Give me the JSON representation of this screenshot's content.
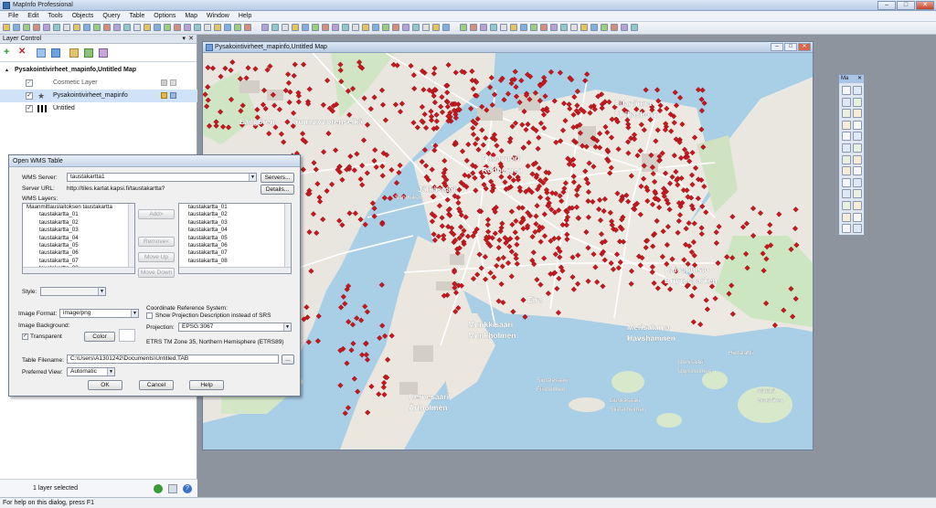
{
  "app": {
    "title": "MapInfo Professional"
  },
  "menu": [
    "File",
    "Edit",
    "Tools",
    "Objects",
    "Query",
    "Table",
    "Options",
    "Map",
    "Window",
    "Help"
  ],
  "layer_control": {
    "title": "Layer Control",
    "root": "Pysakointivirheet_mapinfo,Untitled Map",
    "layers": [
      "Cosmetic Layer",
      "Pysakointivirheet_mapinfo",
      "Untitled"
    ],
    "status": "1 layer selected"
  },
  "map_window": {
    "title": "Pysakointivirheet_mapinfo,Untitled Map",
    "labels": [
      "Punavuori",
      "Rödbergen",
      "Ullanlinna",
      "Ulrikasborg",
      "Kaivopuisto",
      "Brunnsparken",
      "Munkkisaari",
      "Munkholmen",
      "Merisatama",
      "Havshamnen",
      "Hernesaari",
      "Ärtholmen",
      "Jätkäsaari",
      "Sandviken",
      "Sirpalesaari",
      "Flisholmen",
      "Liuskasaari",
      "Skifferholmen",
      "Uunisaari",
      "Ugnsholmen",
      "Särkkä",
      "Langören",
      "Kruunuvuorenselkä",
      "Grasviken",
      "Hietalahti",
      "Eira"
    ],
    "point_color": "#c8181e"
  },
  "palette": {
    "title": "Ma"
  },
  "dialog": {
    "title": "Open WMS Table",
    "wms_server_label": "WMS Server:",
    "wms_server_value": "taustakartta1",
    "servers_button": "Servers...",
    "server_url_label": "Server URL:",
    "server_url_value": "http://tiles.kartat.kapsi.fi/taustakartta?",
    "details_button": "Details...",
    "wms_layers_label": "WMS Layers:",
    "available_layers": [
      "Maanmittauslaitoksen taustakartta",
      "taustakartta_01",
      "taustakartta_02",
      "taustakartta_03",
      "taustakartta_04",
      "taustakartta_05",
      "taustakartta_06",
      "taustakartta_07",
      "taustakartta_08"
    ],
    "selected_layers": [
      "taustakartta_01",
      "taustakartta_02",
      "taustakartta_03",
      "taustakartta_04",
      "taustakartta_05",
      "taustakartta_06",
      "taustakartta_07",
      "taustakartta_08"
    ],
    "add_button": "Add>",
    "remove_button": "Remove<",
    "move_up_button": "Move Up",
    "move_down_button": "Move Down",
    "style_label": "Style:",
    "image_format_label": "Image Format:",
    "image_format_value": "image/png",
    "image_background_label": "Image Background:",
    "transparent_label": "Transparent",
    "color_button": "Color",
    "crs_label": "Coordinate Reference System:",
    "show_proj_label": "Show Projection Description instead of SRS",
    "projection_label": "Projection:",
    "projection_value": "EPSG:3067",
    "projection_desc": "ETRS TM Zone 35, Northern Hemisphere (ETRS89)",
    "table_filename_label": "Table Filename:",
    "table_filename_value": "C:\\Users\\A1301242\\Documents\\Untitled.TAB",
    "browse_button": "...",
    "preferred_view_label": "Preferred View:",
    "preferred_view_value": "Automatic",
    "ok_button": "OK",
    "cancel_button": "Cancel",
    "help_button": "Help"
  },
  "statusbar": {
    "text": "For help on this dialog, press F1"
  }
}
